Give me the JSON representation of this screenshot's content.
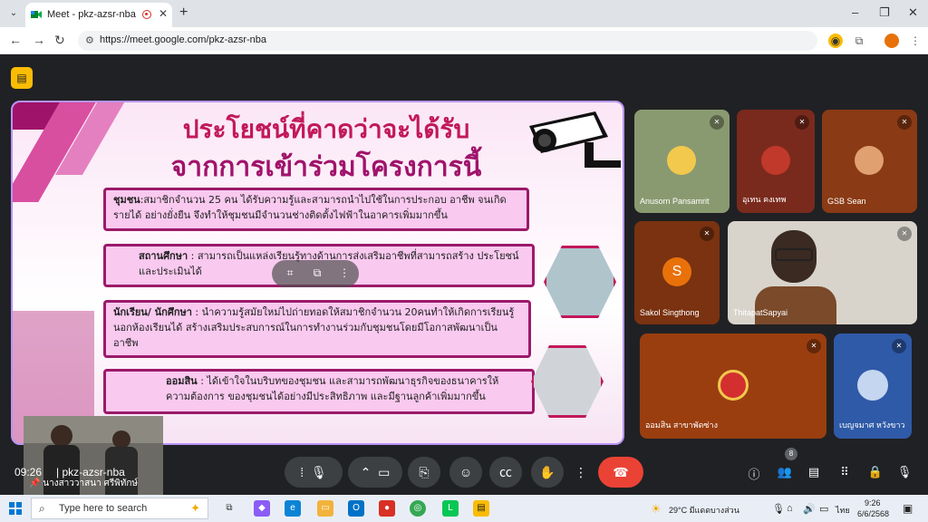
{
  "browser": {
    "tab_title": "Meet - pkz-azsr-nba",
    "new_tab": "+",
    "url": "https://meet.google.com/pkz-azsr-nba",
    "controls": {
      "minimize": "–",
      "maximize": "❐",
      "close": "✕"
    }
  },
  "slide": {
    "title_line1": "ประโยชน์ที่คาดว่าจะได้รับ",
    "title_line2": "จากการเข้าร่วมโครงการนี้",
    "box1_bold": "ชุมชน",
    "box1_text": ":สมาชิกจำนวน 25 คน ได้รับความรู้และสามารถนำไปใช้ในการประกอบ อาชีพ จนเกิดรายได้ อย่างยั่งยืน จึงทำให้ชุมชนมีจำนวนช่างติดตั้งไฟฟ้าในอาคารเพิ่มมากขึ้น",
    "box2_bold": "สถานศึกษา",
    "box2_text": " : สามารถเป็นแหล่งเรียนรู้ทางด้านการส่งเสริมอาชีพที่สามารถสร้าง ประโยชน์และประเมินได้",
    "box3_bold": "นักเรียน/ นักศึกษา",
    "box3_text": " : นำความรู้สมัยใหม่ไปถ่ายทอดให้สมาชิกจำนวน 20คนทำให้เกิดการเรียนรู้นอกห้องเรียนได้ สร้างเสริมประสบการณ์ในการทำงานร่วมกับชุมชนโดยมีโอกาสพัฒนาเป็นอาชีพ",
    "box4_bold": "ออมสิน",
    "box4_text": " : ได้เข้าใจในบริบทของชุมชน และสามารถพัฒนาธุรกิจของธนาคารให้ ความต้องการ ของชุมชนได้อย่างมีประสิทธิภาพ และมีฐานลูกค้าเพิ่มมากขึ้น"
  },
  "pinned_speaker": "นางสาววาสนา ศรีพิทักษ์",
  "participants": [
    {
      "name": "Anusorn Pansamrit"
    },
    {
      "name": "อุเทน คงเทพ"
    },
    {
      "name": "GSB Sean"
    },
    {
      "name": "Sakol Singthong",
      "initial": "S"
    },
    {
      "name": "ThitapatSapyai"
    },
    {
      "name": "ออมสิน สาขาพัดซ่าง"
    },
    {
      "name": "เบญจมาศ หวังขาว"
    }
  ],
  "meeting": {
    "time": "09:26",
    "code": "pkz-azsr-nba",
    "people_count": "8"
  },
  "taskbar": {
    "search_placeholder": "Type here to search",
    "weather": "29°C  มีแดดบางส่วน",
    "lang": "ไทย",
    "clock_time": "9:26",
    "clock_date": "6/6/2568"
  },
  "colors": {
    "accent": "#c2185b",
    "leave": "#ea4335",
    "tile_bg": "#3c4043"
  }
}
